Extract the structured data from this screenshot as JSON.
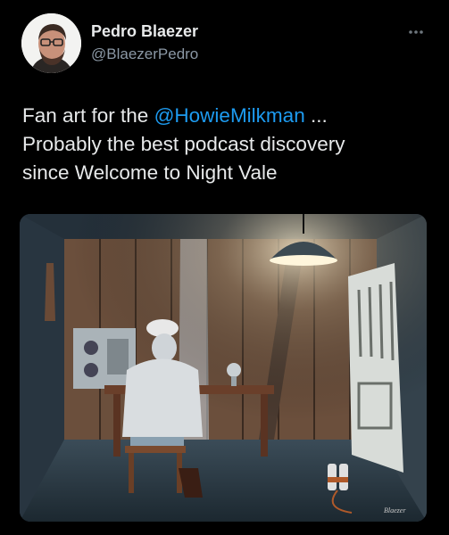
{
  "user": {
    "name": "Pedro Blaezer",
    "handle": "@BlaezerPedro"
  },
  "tweet": {
    "text_before": "Fan art for the ",
    "mention": "@HowieMilkman",
    "text_line1_after": " ...",
    "line2": "Probably the best podcast discovery",
    "line3": "since Welcome to Night Vale"
  },
  "media": {
    "artwork_signature": "Blaezer"
  },
  "icons": {
    "more": "more-horizontal-icon"
  },
  "colors": {
    "background": "#000000",
    "text": "#e7e9ea",
    "secondary": "#8b98a5",
    "link": "#1d9bf0"
  }
}
